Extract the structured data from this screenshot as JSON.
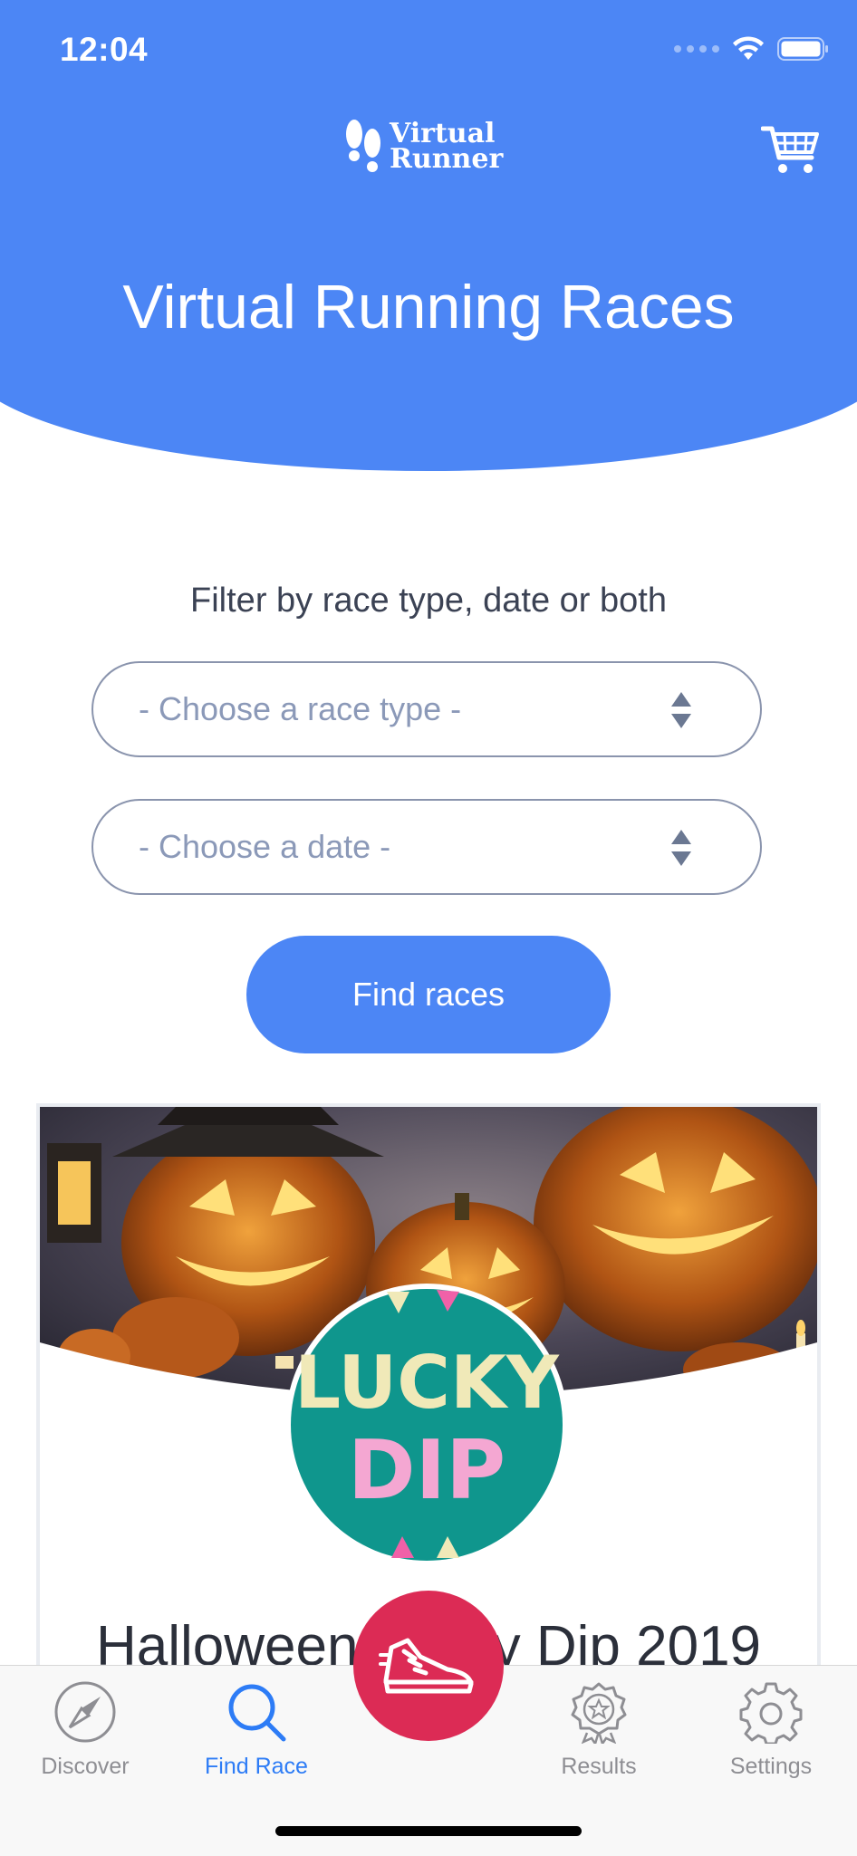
{
  "status_bar": {
    "time": "12:04"
  },
  "header": {
    "logo_text_line1": "Virtual",
    "logo_text_line2": "Runner",
    "title": "Virtual Running Races",
    "cart_icon": "cart-icon"
  },
  "filter": {
    "label": "Filter by race type, date or both",
    "race_type_placeholder": "- Choose a race type -",
    "date_placeholder": "- Choose a date -",
    "find_button": "Find races"
  },
  "race_card": {
    "badge_line1": "LUCKY",
    "badge_line2": "DIP",
    "title": "Halloween Lucky Dip 2019"
  },
  "tabbar": {
    "tabs": [
      {
        "label": "Discover",
        "icon": "compass-icon"
      },
      {
        "label": "Find Race",
        "icon": "search-icon",
        "active": true
      },
      {
        "label": "Results",
        "icon": "medal-icon"
      },
      {
        "label": "Settings",
        "icon": "gear-icon"
      }
    ],
    "center_button_icon": "running-shoe-icon"
  },
  "colors": {
    "brand_blue": "#4c86f5",
    "accent_red": "#dc2b55",
    "active_tab": "#2d7cf6",
    "inactive_tab": "#8e8e93",
    "badge_teal": "#0f968d"
  }
}
